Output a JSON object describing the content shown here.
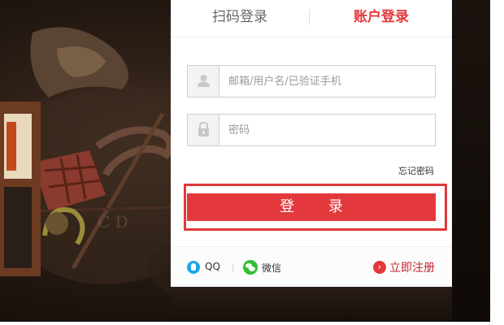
{
  "tabs": {
    "qr": "扫码登录",
    "account": "账户登录"
  },
  "username": {
    "placeholder": "邮箱/用户名/已验证手机",
    "icon": "user-icon"
  },
  "password": {
    "placeholder": "密码",
    "icon": "lock-icon"
  },
  "forgot_password": "忘记密码",
  "login_button": "登 录",
  "footer": {
    "qq_label": "QQ",
    "separator": "|",
    "wechat_label": "微信",
    "register_label": "立即注册",
    "register_icon_glyph": "›"
  },
  "colors": {
    "accent": "#e4393c",
    "qq": "#1aa6ee",
    "wechat": "#2fbf33"
  }
}
